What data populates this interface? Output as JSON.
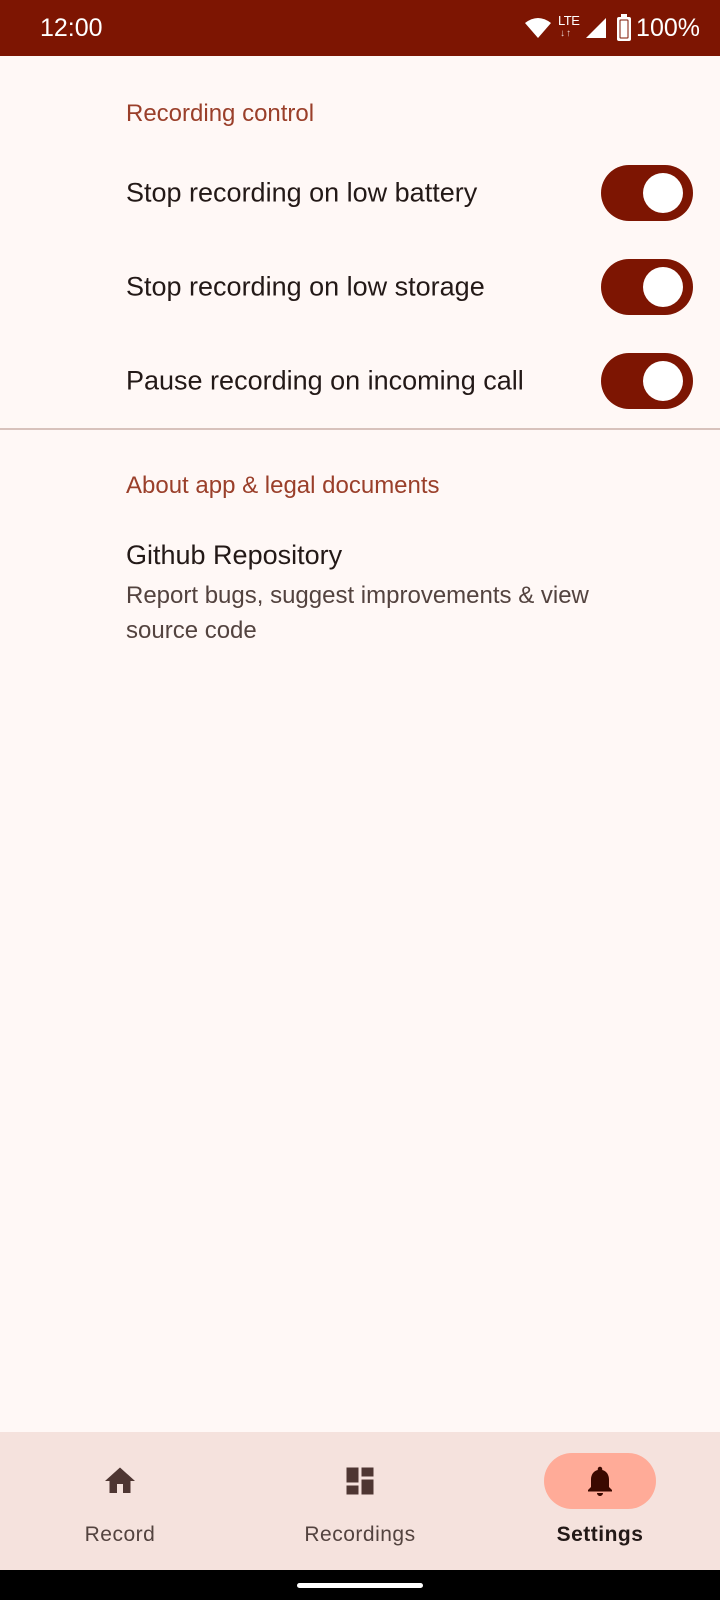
{
  "status_bar": {
    "time": "12:00",
    "network": "LTE",
    "battery": "100%",
    "icons": [
      "wifi-icon",
      "lte-icon",
      "cell-signal-icon",
      "battery-icon"
    ]
  },
  "settings": {
    "recording_section": {
      "header": "Recording control",
      "switches": [
        {
          "label": "Stop recording on low battery",
          "checked": true
        },
        {
          "label": "Stop recording on low storage",
          "checked": true
        },
        {
          "label": "Pause recording on incoming call",
          "checked": true
        }
      ]
    },
    "about_section": {
      "header": "About app & legal documents",
      "items": [
        {
          "title": "Github Repository",
          "summary": "Report bugs, suggest improvements & view source code"
        }
      ]
    }
  },
  "bottom_nav": {
    "items": [
      {
        "label": "Record",
        "icon": "home-icon",
        "active": false
      },
      {
        "label": "Recordings",
        "icon": "dashboard-icon",
        "active": false
      },
      {
        "label": "Settings",
        "icon": "bell-icon",
        "active": true
      }
    ]
  },
  "colors": {
    "primary": "#7d1502",
    "background": "#fff8f6",
    "section_header": "#9a3f2a",
    "nav_background": "#f5e2dd",
    "nav_active_pill": "#ffab98"
  }
}
